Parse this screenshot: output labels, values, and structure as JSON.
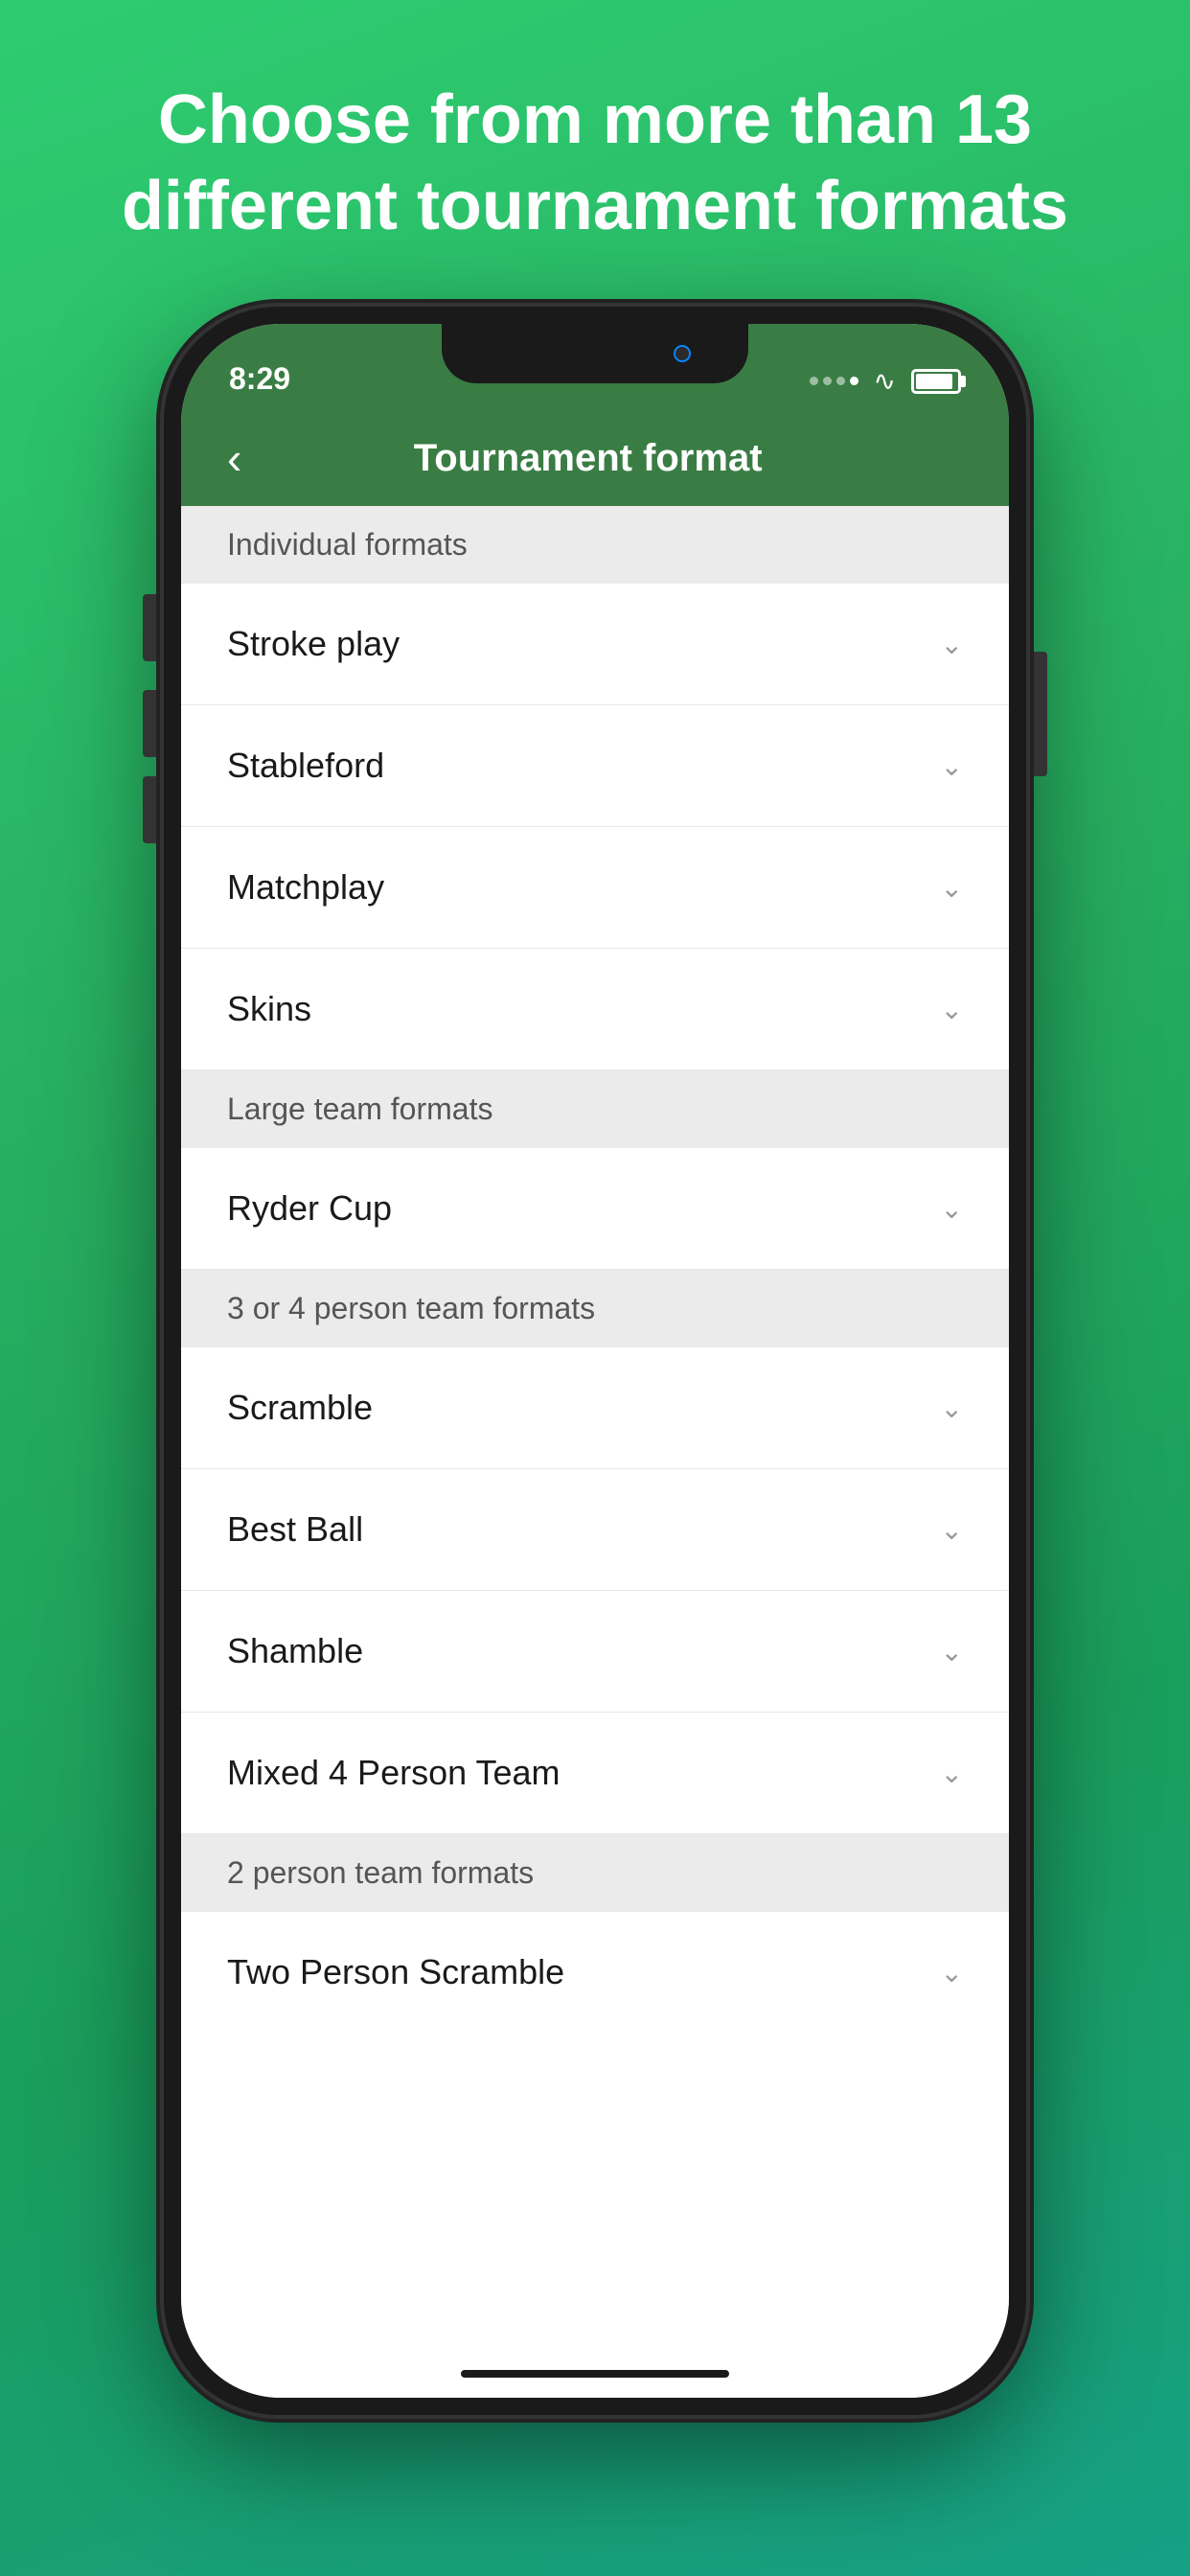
{
  "headline": "Choose from more than 13 different tournament formats",
  "status": {
    "time": "8:29",
    "battery_label": "Battery"
  },
  "nav": {
    "back_label": "‹",
    "title": "Tournament format"
  },
  "sections": [
    {
      "header": "Individual formats",
      "items": [
        {
          "label": "Stroke play"
        },
        {
          "label": "Stableford"
        },
        {
          "label": "Matchplay"
        },
        {
          "label": "Skins"
        }
      ]
    },
    {
      "header": "Large team formats",
      "items": [
        {
          "label": "Ryder Cup"
        }
      ]
    },
    {
      "header": "3 or 4 person team formats",
      "items": [
        {
          "label": "Scramble"
        },
        {
          "label": "Best Ball"
        },
        {
          "label": "Shamble"
        },
        {
          "label": "Mixed 4 Person Team"
        }
      ]
    },
    {
      "header": "2 person team formats",
      "items": [
        {
          "label": "Two Person Scramble"
        }
      ]
    }
  ],
  "colors": {
    "green_header": "#3a7d44",
    "bg_gradient_start": "#2ecc71",
    "bg_gradient_end": "#16a085",
    "section_header_bg": "#ebebeb"
  }
}
